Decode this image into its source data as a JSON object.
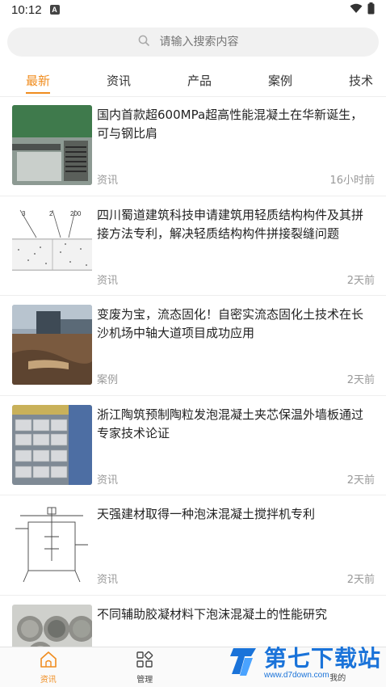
{
  "status": {
    "time": "10:12",
    "notif": "A"
  },
  "search": {
    "placeholder": "请输入搜索内容"
  },
  "tabs": [
    "最新",
    "资讯",
    "产品",
    "案例",
    "技术"
  ],
  "active_tab": 0,
  "feed": [
    {
      "title": "国内首款超600MPa超高性能混凝土在华新诞生，可与钢比肩",
      "category": "资讯",
      "time": "16小时前",
      "thumb": "machine"
    },
    {
      "title": "四川蜀道建筑科技申请建筑用轻质结构构件及其拼接方法专利，解决轻质结构构件拼接裂缝问题",
      "category": "资讯",
      "time": "2天前",
      "thumb": "diagram",
      "thumb_labels": [
        "3",
        "2",
        "200"
      ]
    },
    {
      "title": "变废为宝，流态固化！自密实流态固化土技术在长沙机场中轴大道项目成功应用",
      "category": "案例",
      "time": "2天前",
      "thumb": "site"
    },
    {
      "title": "浙江陶筑预制陶粒发泡混凝土夹芯保温外墙板通过专家技术论证",
      "category": "资讯",
      "time": "2天前",
      "thumb": "blocks"
    },
    {
      "title": "天强建材取得一种泡沫混凝土搅拌机专利",
      "category": "资讯",
      "time": "2天前",
      "thumb": "mixer"
    },
    {
      "title": "不同辅助胶凝材料下泡沫混凝土的性能研究",
      "category": "",
      "time": "",
      "thumb": "powder"
    }
  ],
  "bottom_nav": [
    {
      "label": "资讯",
      "icon": "home-icon"
    },
    {
      "label": "管理",
      "icon": "grid-icon"
    },
    {
      "label": "",
      "icon": ""
    },
    {
      "label": "我的",
      "icon": "user-icon"
    }
  ],
  "watermark": {
    "big": "第七下载站",
    "small": "www.d7down.com"
  },
  "colors": {
    "accent": "#f08c1e",
    "brand_blue": "#1a73d9"
  }
}
